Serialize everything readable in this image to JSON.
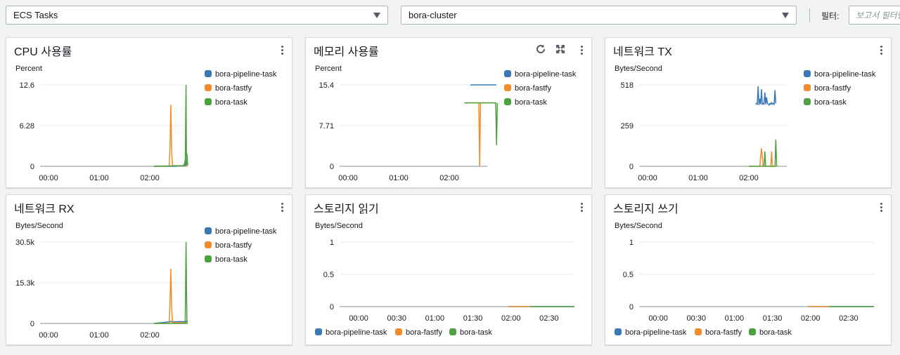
{
  "toolbar": {
    "resource_select": "ECS Tasks",
    "cluster_select": "bora-cluster",
    "filter_label": "필터:",
    "filter_placeholder": "보고서 필터링"
  },
  "colors": {
    "bora-pipeline-task": "#3a78b7",
    "bora-fastfy": "#f08c2e",
    "bora-task": "#4ba23e"
  },
  "legend": [
    "bora-pipeline-task",
    "bora-fastfy",
    "bora-task"
  ],
  "panels": [
    {
      "title": "CPU 사용률",
      "unit": "Percent",
      "icons": [
        "refresh-icon",
        "expand-icon"
      ]
    },
    {
      "title": "메모리 사용률",
      "unit": "Percent"
    },
    {
      "title": "네트워크 TX",
      "unit": "Bytes/Second"
    },
    {
      "title": "네트워크 RX",
      "unit": "Bytes/Second"
    },
    {
      "title": "스토리지 읽기",
      "unit": "Bytes/Second"
    },
    {
      "title": "스토리지 쓰기",
      "unit": "Bytes/Second"
    }
  ],
  "chart_data": [
    {
      "type": "line",
      "title": "CPU 사용률",
      "ylabel": "Percent",
      "x_ticks": [
        "00:00",
        "01:00",
        "02:00"
      ],
      "x_range_minutes": [
        -10,
        165
      ],
      "y_ticks": [
        "0",
        "6.28",
        "12.6"
      ],
      "ylim": [
        0,
        12.6
      ],
      "series": [
        {
          "name": "bora-pipeline-task",
          "x": [
            125,
            150,
            160,
            161,
            162,
            163,
            164
          ],
          "y": [
            0,
            0,
            0.1,
            0.3,
            0.9,
            0.2,
            0.2
          ]
        },
        {
          "name": "bora-fastfy",
          "x": [
            125,
            143,
            144,
            145,
            146,
            147,
            150,
            158,
            164
          ],
          "y": [
            0,
            0,
            3,
            9.5,
            2,
            0.1,
            0.1,
            0.1,
            0.1
          ]
        },
        {
          "name": "bora-task",
          "x": [
            125,
            160,
            162,
            163,
            163.5,
            164,
            165
          ],
          "y": [
            0,
            0.1,
            0.1,
            12.6,
            0.3,
            2,
            0.1
          ]
        }
      ]
    },
    {
      "type": "line",
      "title": "메모리 사용률",
      "ylabel": "Percent",
      "x_ticks": [
        "00:00",
        "01:00",
        "02:00"
      ],
      "x_range_minutes": [
        -10,
        165
      ],
      "y_ticks": [
        "0",
        "7.71",
        "15.4"
      ],
      "ylim": [
        0,
        15.4
      ],
      "series": [
        {
          "name": "bora-pipeline-task",
          "x": [
            145,
            176
          ],
          "y": [
            15.4,
            15.4
          ]
        },
        {
          "name": "bora-fastfy",
          "x": [
            138,
            155,
            156,
            157,
            173
          ],
          "y": [
            12,
            12,
            0,
            12,
            12
          ]
        },
        {
          "name": "bora-task",
          "x": [
            138,
            175,
            176,
            177
          ],
          "y": [
            12,
            12,
            4,
            12
          ]
        }
      ]
    },
    {
      "type": "line",
      "title": "네트워크 TX",
      "ylabel": "Bytes/Second",
      "x_ticks": [
        "00:00",
        "01:00",
        "02:00"
      ],
      "x_range_minutes": [
        -10,
        165
      ],
      "y_ticks": [
        "0",
        "259",
        "518"
      ],
      "ylim": [
        0,
        518
      ],
      "series": [
        {
          "name": "bora-pipeline-task",
          "x": [
            128,
            129,
            130,
            131,
            132,
            133,
            134,
            135,
            136,
            137,
            138,
            139,
            140,
            141,
            142,
            143,
            144,
            145,
            146,
            147,
            148,
            149,
            150,
            151,
            152
          ],
          "y": [
            395,
            400,
            395,
            510,
            390,
            430,
            395,
            490,
            395,
            400,
            395,
            470,
            395,
            440,
            400,
            395,
            390,
            400,
            395,
            405,
            395,
            400,
            395,
            485,
            400
          ]
        },
        {
          "name": "bora-fastfy",
          "x": [
            120,
            133,
            135,
            137,
            139,
            146,
            147,
            148,
            150,
            152
          ],
          "y": [
            0,
            0,
            115,
            0,
            0,
            0,
            95,
            0,
            0,
            0
          ]
        },
        {
          "name": "bora-task",
          "x": [
            120,
            138,
            139,
            140,
            149,
            151,
            152,
            153
          ],
          "y": [
            0,
            0,
            95,
            0,
            0,
            0,
            170,
            0
          ]
        }
      ]
    },
    {
      "type": "line",
      "title": "네트워크 RX",
      "ylabel": "Bytes/Second",
      "x_ticks": [
        "00:00",
        "01:00",
        "02:00"
      ],
      "x_range_minutes": [
        -10,
        165
      ],
      "y_ticks": [
        "0",
        "15.3k",
        "30.5k"
      ],
      "ylim": [
        0,
        30500
      ],
      "series": [
        {
          "name": "bora-pipeline-task",
          "x": [
            125,
            143,
            145,
            150,
            155,
            160,
            163,
            165
          ],
          "y": [
            0,
            600,
            700,
            600,
            700,
            650,
            700,
            700
          ]
        },
        {
          "name": "bora-fastfy",
          "x": [
            125,
            143,
            144,
            145,
            146,
            147,
            164
          ],
          "y": [
            0,
            0,
            8000,
            20500,
            5000,
            300,
            300
          ]
        },
        {
          "name": "bora-task",
          "x": [
            125,
            162,
            163,
            164,
            165
          ],
          "y": [
            0,
            0,
            30500,
            0,
            0
          ]
        }
      ]
    },
    {
      "type": "line",
      "title": "스토리지 읽기",
      "ylabel": "Bytes/Second",
      "x_ticks": [
        "00:00",
        "00:30",
        "01:00",
        "01:30",
        "02:00",
        "02:30"
      ],
      "x_range_minutes": [
        -15,
        170
      ],
      "y_ticks": [
        "0",
        "0.5",
        "1"
      ],
      "ylim": [
        0,
        1
      ],
      "series": [
        {
          "name": "bora-pipeline-task",
          "x": [
            118,
            170
          ],
          "y": [
            0,
            0
          ]
        },
        {
          "name": "bora-fastfy",
          "x": [
            118,
            135
          ],
          "y": [
            0,
            0
          ]
        },
        {
          "name": "bora-task",
          "x": [
            135,
            170
          ],
          "y": [
            0,
            0
          ]
        }
      ]
    },
    {
      "type": "line",
      "title": "스토리지 쓰기",
      "ylabel": "Bytes/Second",
      "x_ticks": [
        "00:00",
        "00:30",
        "01:00",
        "01:30",
        "02:00",
        "02:30"
      ],
      "x_range_minutes": [
        -15,
        170
      ],
      "y_ticks": [
        "0",
        "0.5",
        "1"
      ],
      "ylim": [
        0,
        1
      ],
      "series": [
        {
          "name": "bora-pipeline-task",
          "x": [
            118,
            170
          ],
          "y": [
            0,
            0
          ]
        },
        {
          "name": "bora-fastfy",
          "x": [
            118,
            135
          ],
          "y": [
            0,
            0
          ]
        },
        {
          "name": "bora-task",
          "x": [
            135,
            170
          ],
          "y": [
            0,
            0
          ]
        }
      ]
    }
  ]
}
